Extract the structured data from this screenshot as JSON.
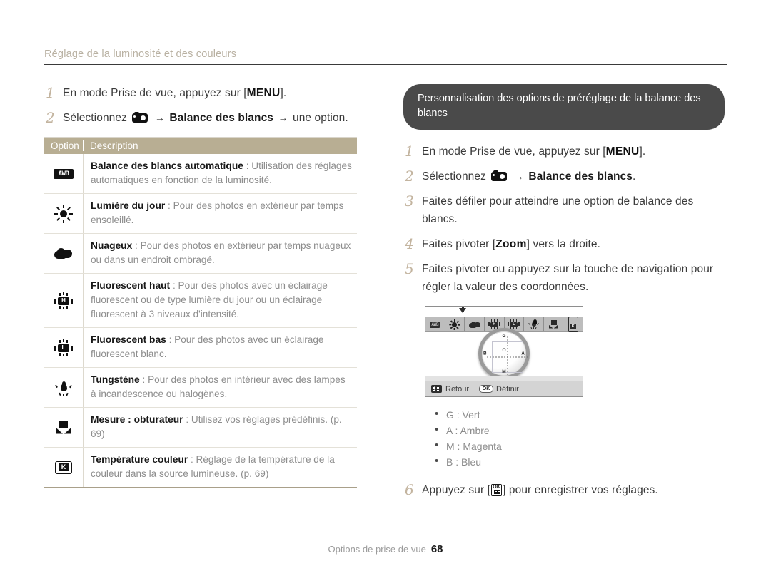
{
  "header": {
    "section_title": "Réglage de la luminosité et des couleurs"
  },
  "left": {
    "steps": [
      {
        "num": "1",
        "pre": "En mode Prise de vue, appuyez sur [",
        "key": "MENU",
        "post": "]."
      },
      {
        "num": "2",
        "pre": "Sélectionnez",
        "icon": "camera-icon",
        "mid": "Balance des blancs",
        "post": "une option."
      }
    ],
    "table": {
      "headers": [
        "Option",
        "Description"
      ],
      "rows": [
        {
          "icon": "awb-icon",
          "icon_text": "AWB",
          "term": "Balance des blancs automatique",
          "desc": " : Utilisation des réglages automatiques en fonction de la luminosité."
        },
        {
          "icon": "sun-icon",
          "icon_text": "",
          "term": "Lumière du jour",
          "desc": " : Pour des photos en extérieur par temps ensoleillé."
        },
        {
          "icon": "cloud-icon",
          "icon_text": "",
          "term": "Nuageux",
          "desc": " : Pour des photos en extérieur par temps nuageux ou dans un endroit ombragé."
        },
        {
          "icon": "fluorescent-high-icon",
          "icon_text": "H",
          "term": "Fluorescent haut",
          "desc": " : Pour des photos avec un éclairage fluorescent ou de type lumière du jour ou un éclairage fluorescent à 3 niveaux d'intensité."
        },
        {
          "icon": "fluorescent-low-icon",
          "icon_text": "L",
          "term": "Fluorescent bas",
          "desc": " : Pour des photos avec un éclairage fluorescent blanc."
        },
        {
          "icon": "tungsten-icon",
          "icon_text": "",
          "term": "Tungstène",
          "desc": " : Pour des photos en intérieur avec des lampes à incandescence ou halogènes."
        },
        {
          "icon": "measure-shutter-icon",
          "icon_text": "",
          "term": "Mesure : obturateur",
          "desc": " : Utilisez vos réglages prédéfinis. (p. 69)"
        },
        {
          "icon": "color-temperature-k-icon",
          "icon_text": "K",
          "term": "Température couleur",
          "desc": " : Réglage de la température de la couleur dans la source lumineuse. (p. 69)"
        }
      ]
    }
  },
  "right": {
    "callout_title": "Personnalisation des options de préréglage de la balance des blancs",
    "steps": [
      {
        "num": "1",
        "pre": "En mode Prise de vue, appuyez sur [",
        "key": "MENU",
        "post": "]."
      },
      {
        "num": "2",
        "pre": "Sélectionnez",
        "icon": "camera-icon",
        "mid": "Balance des blancs",
        "post": "."
      },
      {
        "num": "3",
        "text": "Faites défiler pour atteindre une option de balance des blancs."
      },
      {
        "num": "4",
        "pre": "Faites pivoter [",
        "key": "Zoom",
        "post": "] vers la droite."
      },
      {
        "num": "5",
        "text": "Faites pivoter ou appuyez sur la touche de navigation pour régler la valeur des coordonnées."
      }
    ],
    "camera_screen": {
      "toolbar_icons": [
        {
          "name": "awb-icon",
          "text": "AWB",
          "selected": false
        },
        {
          "name": "sun-icon",
          "text": "",
          "selected": true
        },
        {
          "name": "cloud-icon",
          "text": "",
          "selected": false
        },
        {
          "name": "fluorescent-high-icon",
          "text": "H",
          "selected": false
        },
        {
          "name": "fluorescent-low-icon",
          "text": "L",
          "selected": false
        },
        {
          "name": "tungsten-icon",
          "text": "",
          "selected": false
        },
        {
          "name": "measure-shutter-icon",
          "text": "",
          "selected": false
        },
        {
          "name": "color-temperature-k-icon",
          "text": "K",
          "selected": false
        }
      ],
      "wheel_labels": {
        "top": "G",
        "bottom": "M",
        "right": "A",
        "left": "B",
        "center": "O"
      },
      "back_label": "Retour",
      "ok_label": "OK",
      "set_label": "Définir"
    },
    "bullets": [
      "G : Vert",
      "A : Ambre",
      "M : Magenta",
      "B : Bleu"
    ],
    "final_step": {
      "num": "6",
      "pre": "Appuyez sur [",
      "post": "] pour enregistrer vos réglages."
    }
  },
  "footer": {
    "label": "Options de prise de vue",
    "page": "68"
  }
}
